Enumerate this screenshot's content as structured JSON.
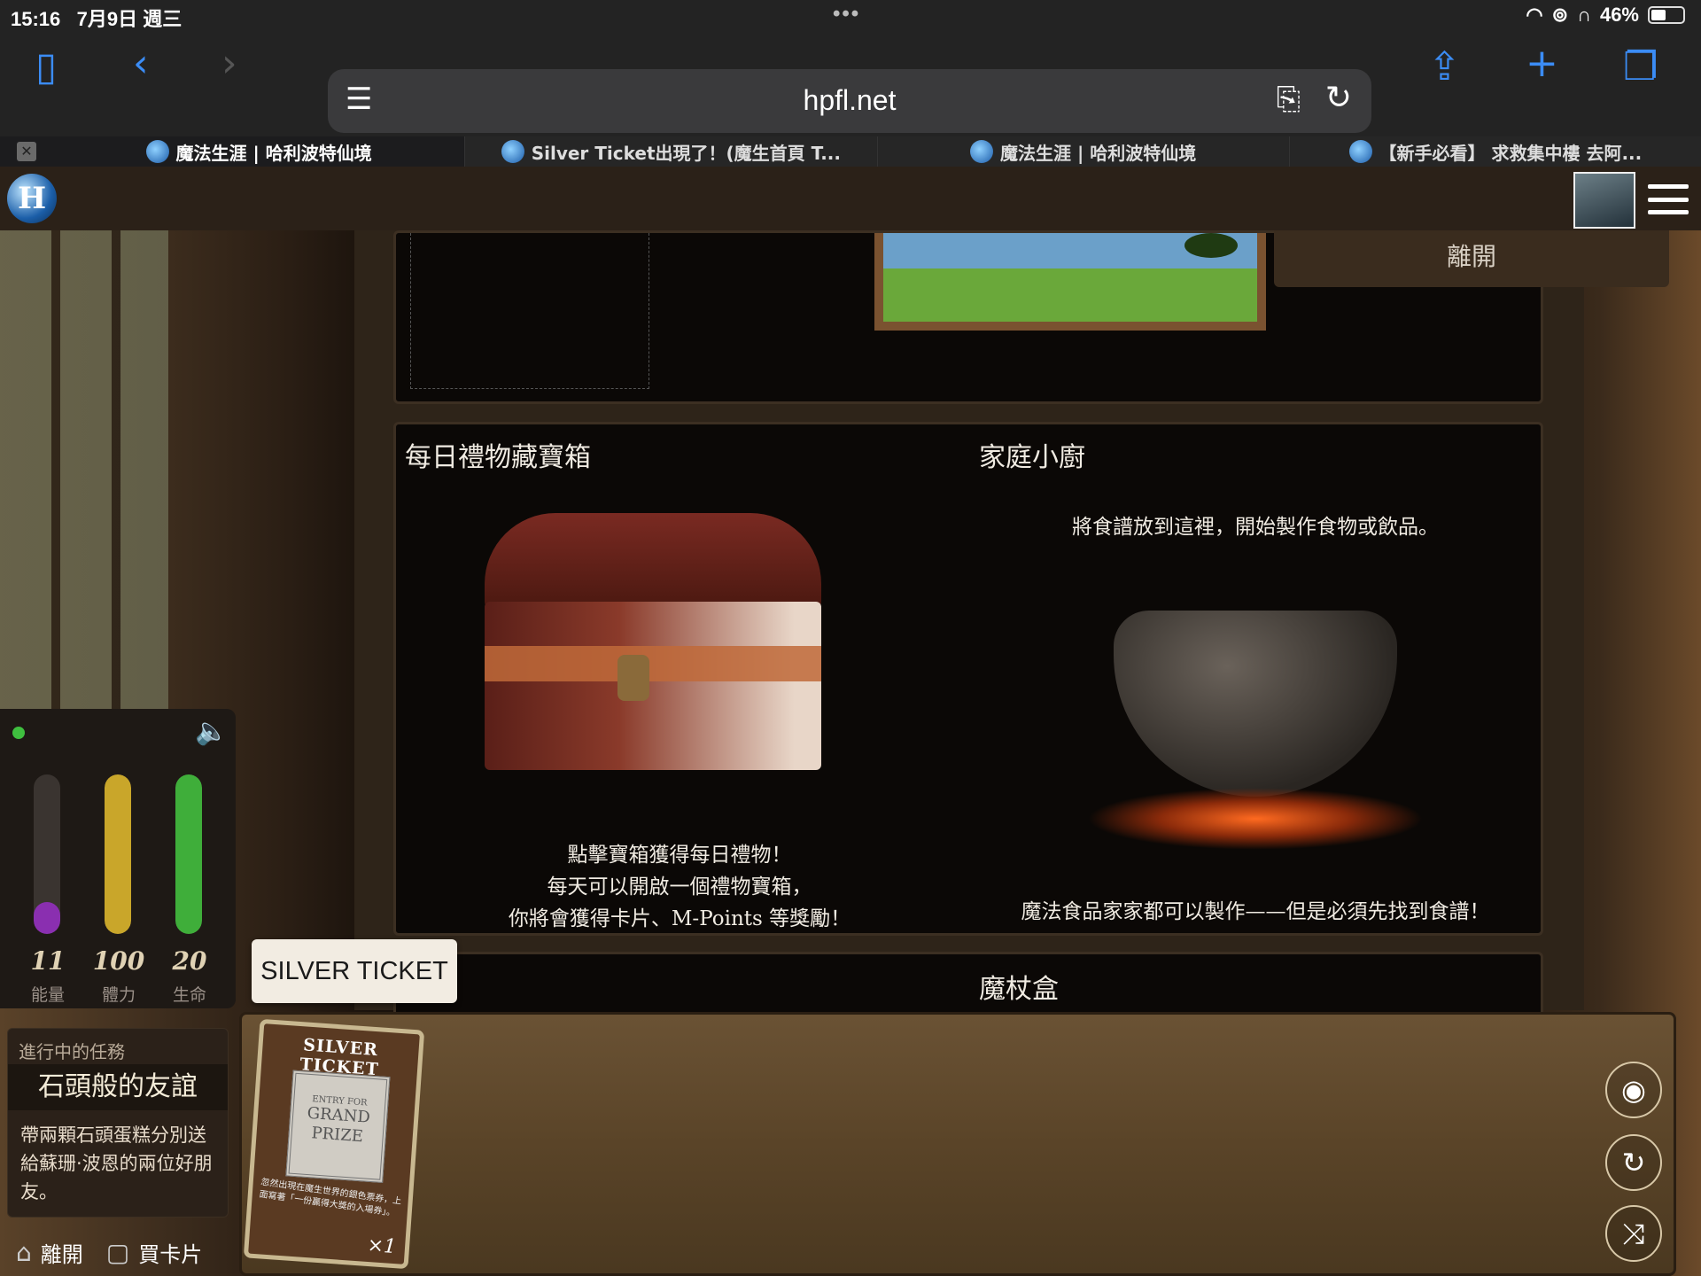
{
  "status": {
    "time": "15:16",
    "date": "7月9日 週三",
    "battery": "46%",
    "battery_fraction": 0.46
  },
  "browser": {
    "url": "hpfl.net"
  },
  "tabs": [
    {
      "title": "魔法生涯 | 哈利波特仙境"
    },
    {
      "title": "Silver Ticket出現了！(魔生首頁 T..."
    },
    {
      "title": "魔法生涯 | 哈利波特仙境"
    },
    {
      "title": "【新手必看】 求救集中樓  去阿..."
    }
  ],
  "site": {
    "logo_text": "H"
  },
  "exit_label": "離開",
  "daily_chest": {
    "title": "每日禮物藏寶箱",
    "line1": "點擊寶箱獲得每日禮物！",
    "line2": "每天可以開啟一個禮物寶箱，",
    "line3": "你將會獲得卡片、M-Points 等獎勵！"
  },
  "kitchen": {
    "title": "家庭小廚",
    "instruction": "將食譜放到這裡，開始製作食物或飲品。",
    "footer": "魔法食品家家都可以製作——但是必須先找到食譜！"
  },
  "wand_box": {
    "title": "魔杖盒"
  },
  "stats": [
    {
      "value": "11",
      "label": "能量",
      "fraction": 0.2,
      "color": "#8a2fb0"
    },
    {
      "value": "100",
      "label": "體力",
      "fraction": 1.0,
      "color": "#c9a62a"
    },
    {
      "value": "20",
      "label": "生命",
      "fraction": 1.0,
      "color": "#3fae3a"
    }
  ],
  "quest": {
    "header": "進行中的任務",
    "title": "石頭般的友誼",
    "description": "帶兩顆石頭蛋糕分別送給蘇珊·波恩的兩位好朋友。"
  },
  "bottom_nav": {
    "leave": "離開",
    "buy_cards": "買卡片"
  },
  "tooltip": "SILVER TICKET",
  "card": {
    "title": "SILVER TICKET",
    "stamp_small": "ENTRY FOR",
    "stamp_big1": "GRAND",
    "stamp_big2": "PRIZE",
    "desc": "忽然出現在魔生世界的銀色票券，上面寫著「一份贏得大獎的入場券」。",
    "count": "×1"
  }
}
